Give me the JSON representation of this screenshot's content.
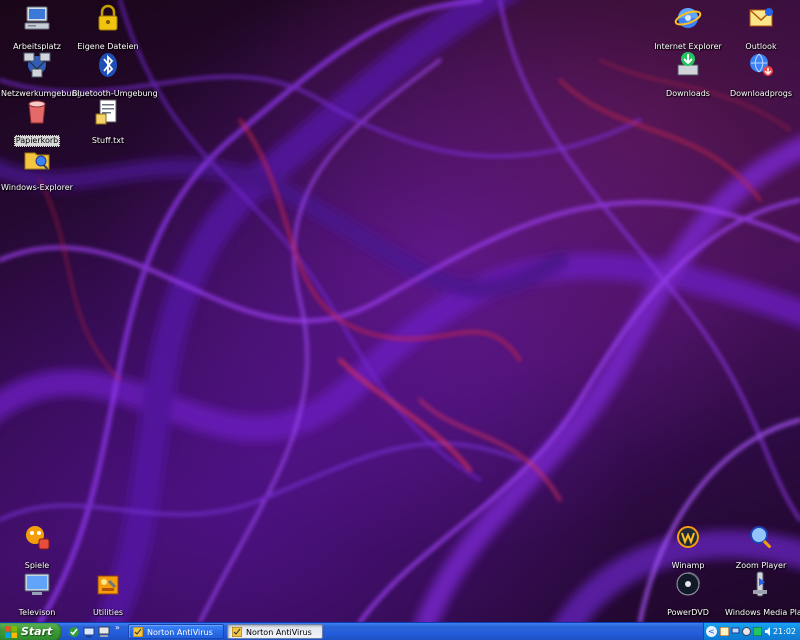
{
  "desktop": {
    "icons_left": [
      {
        "label": "Arbeitsplatz",
        "icon": "my-computer-icon"
      },
      {
        "label": "Eigene Dateien",
        "icon": "my-documents-lock-icon"
      },
      {
        "label": "Netzwerkumgebung",
        "icon": "network-places-icon"
      },
      {
        "label": "Bluetooth-Umgebung",
        "icon": "bluetooth-icon"
      },
      {
        "label": "Papierkorb",
        "icon": "recycle-bin-icon"
      },
      {
        "label": "Stuff.txt",
        "icon": "text-file-icon"
      },
      {
        "label": "Windows-Explorer",
        "icon": "windows-explorer-icon"
      },
      {
        "label": "Spiele",
        "icon": "games-icon"
      },
      {
        "label": "Televison",
        "icon": "television-icon"
      },
      {
        "label": "Utilities",
        "icon": "utilities-icon"
      }
    ],
    "icons_right": [
      {
        "label": "Internet Explorer",
        "icon": "internet-explorer-icon"
      },
      {
        "label": "Outlook",
        "icon": "outlook-icon"
      },
      {
        "label": "Downloads",
        "icon": "downloads-icon"
      },
      {
        "label": "Downloadprogs",
        "icon": "downloadprogs-icon"
      },
      {
        "label": "Winamp",
        "icon": "winamp-icon"
      },
      {
        "label": "Zoom Player",
        "icon": "zoom-player-icon"
      },
      {
        "label": "PowerDVD",
        "icon": "powerdvd-icon"
      },
      {
        "label": "Windows Media Player",
        "icon": "windows-media-player-icon"
      }
    ]
  },
  "taskbar": {
    "start_label": "Start",
    "quicklaunch_more": "»",
    "tasks": [
      {
        "label": "Norton AntiVirus",
        "icon": "norton-antivirus-icon",
        "active": false
      },
      {
        "label": "Norton AntiVirus",
        "icon": "norton-antivirus-icon",
        "active": true
      }
    ],
    "tray": {
      "chevron": "<",
      "clock": "21:02"
    }
  },
  "colors": {
    "taskbar_blue": "#245ddb",
    "start_green": "#3d9a3a",
    "tray_blue": "#0f8ae0"
  }
}
